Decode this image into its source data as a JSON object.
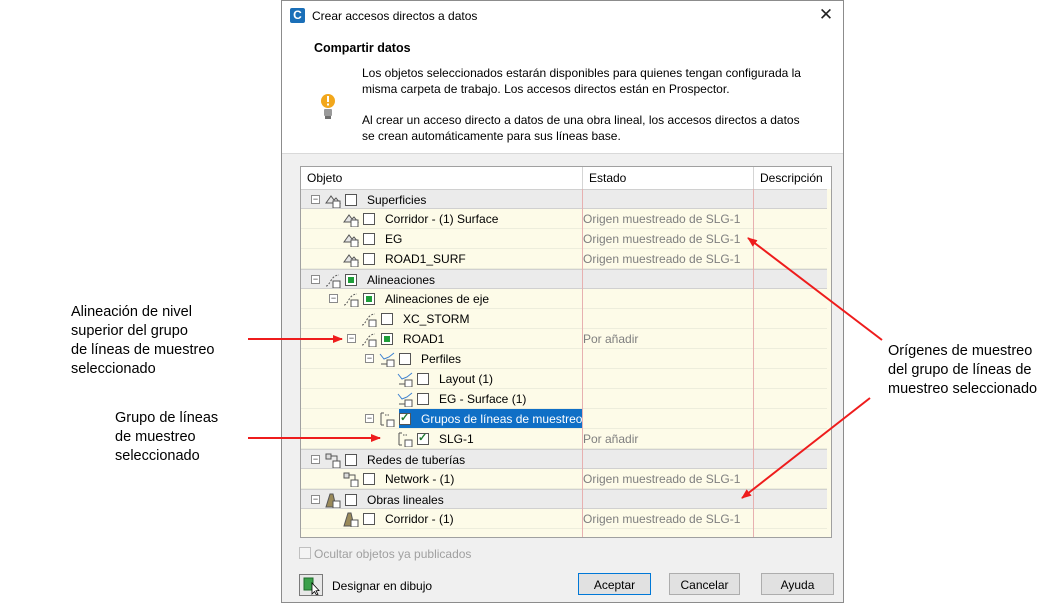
{
  "annotations": {
    "left1_l1": "Alineación de nivel",
    "left1_l2": "superior del grupo",
    "left1_l3": "de líneas de muestreo",
    "left1_l4": "seleccionado",
    "left2_l1": "Grupo de líneas",
    "left2_l2": "de muestreo",
    "left2_l3": "seleccionado",
    "right_l1": "Orígenes de muestreo",
    "right_l2": "del grupo de líneas de",
    "right_l3": "muestreo seleccionado"
  },
  "dialog": {
    "title": "Crear accesos directos a datos",
    "close_symbol": "✕",
    "section_title": "Compartir datos",
    "para1_l1": "Los objetos seleccionados estarán disponibles para quienes tengan configurada la",
    "para1_l2": "misma carpeta de trabajo. Los accesos directos están en Prospector.",
    "para2_l1": "Al crear un acceso directo a datos de una obra lineal, los accesos directos a datos",
    "para2_l2": "se crean automáticamente para sus líneas base.",
    "columns": {
      "objeto": "Objeto",
      "estado": "Estado",
      "descripcion": "Descripción"
    },
    "rows": [
      {
        "label": "Superficies",
        "status": ""
      },
      {
        "label": "Corridor - (1) Surface",
        "status": "Origen muestreado de SLG-1"
      },
      {
        "label": "EG",
        "status": "Origen muestreado de SLG-1"
      },
      {
        "label": "ROAD1_SURF",
        "status": "Origen muestreado de SLG-1"
      },
      {
        "label": "Alineaciones",
        "status": ""
      },
      {
        "label": "Alineaciones de eje",
        "status": ""
      },
      {
        "label": "XC_STORM",
        "status": ""
      },
      {
        "label": "ROAD1",
        "status": "Por añadir"
      },
      {
        "label": "Perfiles",
        "status": ""
      },
      {
        "label": "Layout (1)",
        "status": ""
      },
      {
        "label": "EG - Surface (1)",
        "status": ""
      },
      {
        "label": "Grupos de líneas de muestreo",
        "status": ""
      },
      {
        "label": "SLG-1",
        "status": "Por añadir"
      },
      {
        "label": "Redes de tuberías",
        "status": ""
      },
      {
        "label": "Network - (1)",
        "status": "Origen muestreado de SLG-1"
      },
      {
        "label": "Obras lineales",
        "status": ""
      },
      {
        "label": "Corridor - (1)",
        "status": "Origen muestreado de SLG-1"
      }
    ],
    "ocultar_label": "Ocultar objetos ya publicados",
    "designar_label": "Designar en dibujo",
    "btn_aceptar": "Aceptar",
    "btn_cancelar": "Cancelar",
    "btn_ayuda": "Ayuda"
  }
}
